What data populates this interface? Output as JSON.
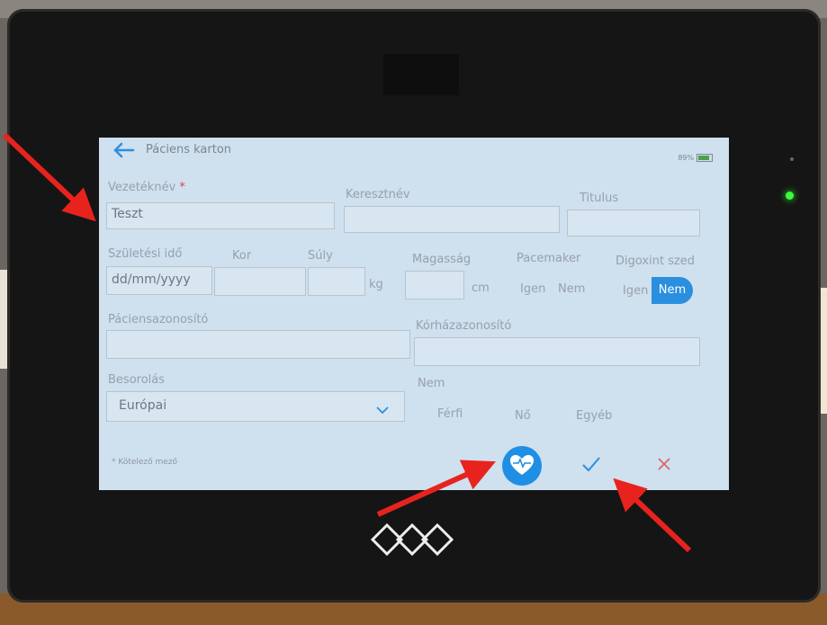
{
  "screen": {
    "title": "Páciens karton",
    "battery": "89%",
    "fields": {
      "last_name_label": "Vezetéknév",
      "required_star": "*",
      "last_name_value": "Teszt",
      "first_name_label": "Keresztnév",
      "title_label": "Titulus",
      "birth_date_label": "Születési idő",
      "birth_date_placeholder": "dd/mm/yyyy",
      "age_label": "Kor",
      "weight_label": "Súly",
      "weight_unit": "kg",
      "height_label": "Magasság",
      "height_unit": "cm",
      "pacemaker_label": "Pacemaker",
      "pacemaker_yes": "Igen",
      "pacemaker_no": "Nem",
      "digoxin_label": "Digoxint szed",
      "digoxin_yes": "Igen",
      "digoxin_no": "Nem",
      "patient_id_label": "Páciensazonosító",
      "hospital_id_label": "Kórházazonosító",
      "classification_label": "Besorolás",
      "classification_value": "Európai",
      "sex_label": "Nem",
      "sex_male": "Férfi",
      "sex_female": "Nő",
      "sex_other": "Egyéb"
    },
    "footer": {
      "required_note": "* Kötelező mező"
    }
  },
  "colors": {
    "accent": "#2b8fe0",
    "arrow": "#e8231e",
    "required": "#e0463c",
    "led": "#39ff3a"
  }
}
